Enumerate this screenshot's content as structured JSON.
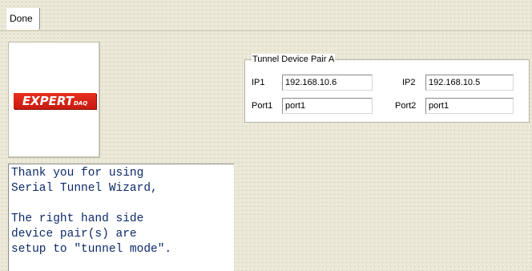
{
  "tab": {
    "label": "Done"
  },
  "logo": {
    "text": "EXPERT",
    "subtext": "DAQ"
  },
  "message": {
    "lines": [
      "Thank you for using",
      "Serial Tunnel Wizard,",
      "",
      "The right hand side",
      "device pair(s) are",
      "setup to \"tunnel mode\"."
    ]
  },
  "tunnel_group": {
    "title": "Tunnel Device Pair A",
    "ip1": {
      "label": "IP1",
      "value": "192.168.10.6"
    },
    "ip2": {
      "label": "IP2",
      "value": "192.168.10.5"
    },
    "port1": {
      "label": "Port1",
      "value": "port1"
    },
    "port2": {
      "label": "Port2",
      "value": "port1"
    }
  },
  "colors": {
    "window_bg": "#ece9d8",
    "logo_red": "#e02a1c",
    "message_text": "#0c2a6a"
  }
}
